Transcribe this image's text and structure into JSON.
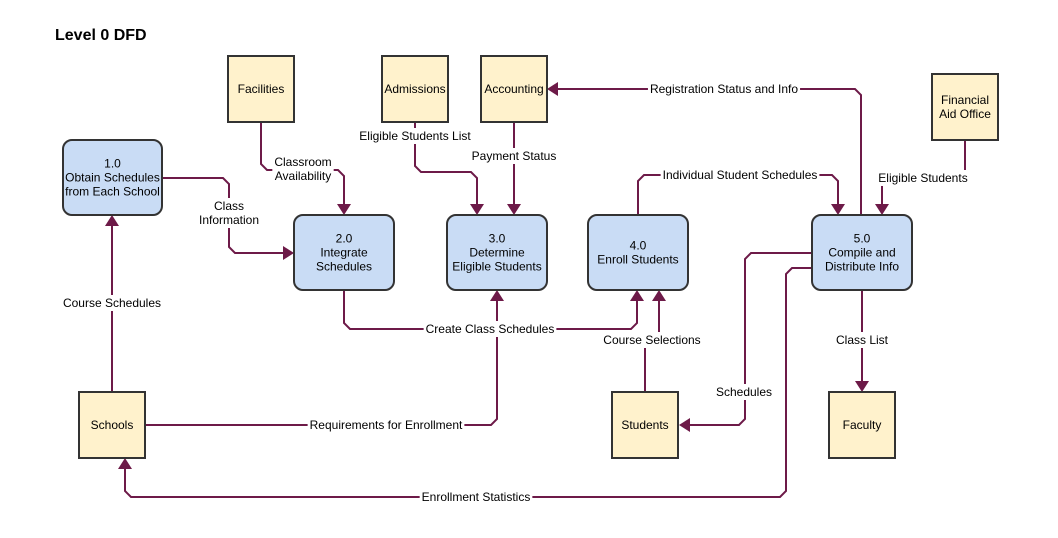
{
  "title": "Level 0 DFD",
  "colors": {
    "process_fill": "#c9dcf5",
    "entity_fill": "#fff2cc",
    "border": "#333333",
    "flow": "#6d1a48"
  },
  "processes": [
    {
      "id": "p1",
      "number": "1.0",
      "lines": [
        "Obtain Schedules",
        "from Each School"
      ]
    },
    {
      "id": "p2",
      "number": "2.0",
      "lines": [
        "Integrate",
        "Schedules"
      ]
    },
    {
      "id": "p3",
      "number": "3.0",
      "lines": [
        "Determine",
        "Eligible Students"
      ]
    },
    {
      "id": "p4",
      "number": "4.0",
      "lines": [
        "Enroll Students"
      ]
    },
    {
      "id": "p5",
      "number": "5.0",
      "lines": [
        "Compile and",
        "Distribute Info"
      ]
    }
  ],
  "entities": [
    {
      "id": "facilities",
      "lines": [
        "Facilities"
      ]
    },
    {
      "id": "admissions",
      "lines": [
        "Admissions"
      ]
    },
    {
      "id": "accounting",
      "lines": [
        "Accounting"
      ]
    },
    {
      "id": "financial-aid",
      "lines": [
        "Financial",
        "Aid Office"
      ]
    },
    {
      "id": "schools",
      "lines": [
        "Schools"
      ]
    },
    {
      "id": "students",
      "lines": [
        "Students"
      ]
    },
    {
      "id": "faculty",
      "lines": [
        "Faculty"
      ]
    }
  ],
  "flows": [
    {
      "id": "course-schedules",
      "from": "schools",
      "to": "p1",
      "lines": [
        "Course Schedules"
      ]
    },
    {
      "id": "class-information",
      "from": "p1",
      "to": "p2",
      "lines": [
        "Class",
        "Information"
      ]
    },
    {
      "id": "classroom-availability",
      "from": "facilities",
      "to": "p2",
      "lines": [
        "Classroom",
        "Availability"
      ]
    },
    {
      "id": "eligible-students-list",
      "from": "admissions",
      "to": "p3",
      "lines": [
        "Eligible Students List"
      ]
    },
    {
      "id": "payment-status",
      "from": "accounting",
      "to": "p3",
      "lines": [
        "Payment Status"
      ]
    },
    {
      "id": "registration-status",
      "from": "p5",
      "to": "accounting",
      "lines": [
        "Registration Status and Info"
      ]
    },
    {
      "id": "individual-student-schedules",
      "from": "p4",
      "to": "p5",
      "lines": [
        "Individual Student Schedules"
      ]
    },
    {
      "id": "eligible-students",
      "from": "financial-aid",
      "to": "p5",
      "lines": [
        "Eligible Students"
      ]
    },
    {
      "id": "create-class-schedules",
      "from": "p2",
      "to": "p4",
      "lines": [
        "Create Class Schedules"
      ]
    },
    {
      "id": "requirements-for-enrollment",
      "from": "schools",
      "to": "p3",
      "lines": [
        "Requirements for Enrollment"
      ]
    },
    {
      "id": "course-selections",
      "from": "students",
      "to": "p4",
      "lines": [
        "Course Selections"
      ]
    },
    {
      "id": "schedules",
      "from": "p5",
      "to": "students",
      "lines": [
        "Schedules"
      ]
    },
    {
      "id": "class-list",
      "from": "p5",
      "to": "faculty",
      "lines": [
        "Class List"
      ]
    },
    {
      "id": "enrollment-statistics",
      "from": "p5",
      "to": "schools",
      "lines": [
        "Enrollment Statistics"
      ]
    }
  ]
}
